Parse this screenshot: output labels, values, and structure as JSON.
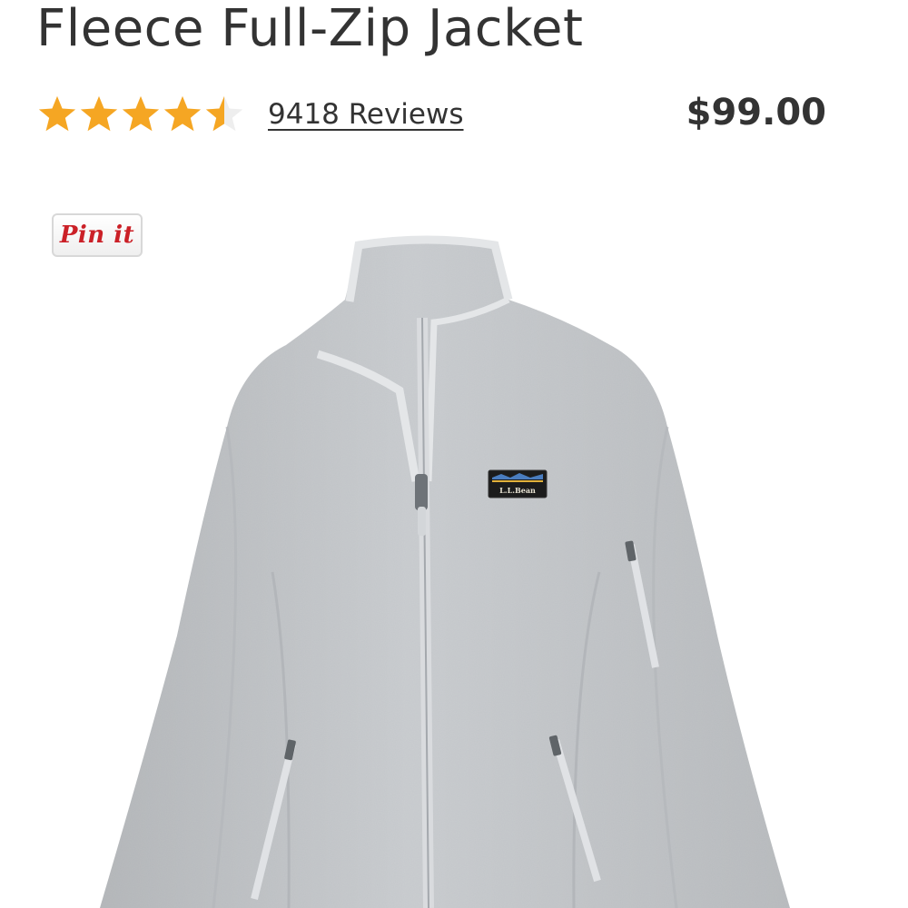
{
  "product": {
    "title": "Fleece Full-Zip Jacket",
    "rating": 4.5,
    "rating_max": 5,
    "reviews_label": "9418 Reviews",
    "price": "$99.00"
  },
  "pin_button": {
    "label": "Pin it"
  },
  "patch": {
    "brand": "L.L.Bean"
  },
  "colors": {
    "star": "#f5a623",
    "text": "#333333",
    "pin_red": "#cb2027",
    "fleece": "#c9cccf"
  }
}
